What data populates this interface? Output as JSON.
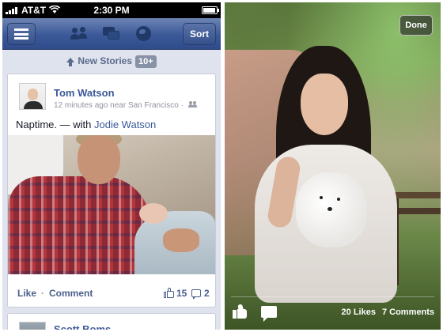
{
  "status_bar": {
    "carrier": "AT&T",
    "time": "2:30 PM"
  },
  "nav_bar": {
    "sort_label": "Sort",
    "icons": [
      "menu-icon",
      "friends-icon",
      "messages-icon",
      "globe-icon"
    ]
  },
  "new_stories": {
    "label": "New Stories",
    "count": "10+"
  },
  "story": {
    "author": "Tom Watson",
    "meta": "12 minutes ago near San Francisco",
    "status": "Naptime. — with ",
    "tagged": "Jodie Watson",
    "like_label": "Like",
    "separator": "·",
    "comment_label": "Comment",
    "likes": "15",
    "comments": "2"
  },
  "next_story": {
    "author": "Scott Boms"
  },
  "photo_viewer": {
    "done_label": "Done",
    "likes_text": "20 Likes",
    "comments_text": "7 Comments"
  },
  "colors": {
    "brand": "#3b5998",
    "feed_background": "#dfe3ee",
    "link": "#3b5998"
  }
}
